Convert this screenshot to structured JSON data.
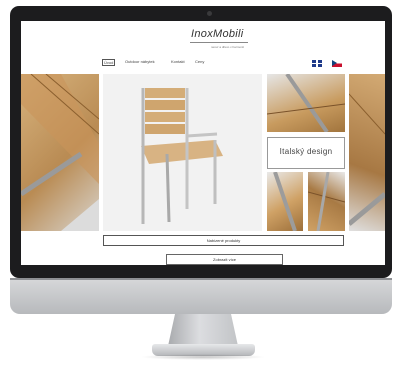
{
  "site": {
    "logo": "InoxMobili",
    "tagline": "nerez a dřevo v harmonii"
  },
  "nav": {
    "items": [
      "Úvod",
      "Outdoor nábytek",
      "Kontakt",
      "Ceny"
    ]
  },
  "language_flags": [
    "flag-uk-icon",
    "flag-cz-icon"
  ],
  "gallery": {
    "design_caption": "Italský design"
  },
  "buttons": {
    "products": "Nabízené produkty",
    "more": "Zobrazit více"
  },
  "colors": {
    "bezel": "#1c1c1e",
    "wood": "#c89b5f",
    "steel": "#b8b8b8",
    "page": "#ffffff"
  }
}
